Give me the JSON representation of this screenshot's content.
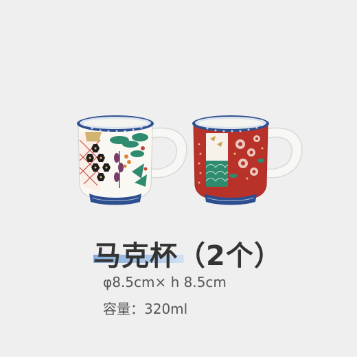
{
  "product": {
    "title": "马克杯（2个）",
    "size": "φ8.5cm× h 8.5cm",
    "capacity_label": "容量：",
    "capacity_value": "320ml"
  },
  "colors": {
    "background": "#efefef",
    "title_text": "#333333",
    "highlight": "#8fb5e3",
    "spec_text": "#555555",
    "mug_blue": "#2e4f8f",
    "mug_red": "#b8322a",
    "mug_green": "#2e8b6f",
    "mug_gold": "#c9a451"
  },
  "images": {
    "left_mug": "mug-patterned-white-icon",
    "right_mug": "mug-patterned-red-icon"
  }
}
